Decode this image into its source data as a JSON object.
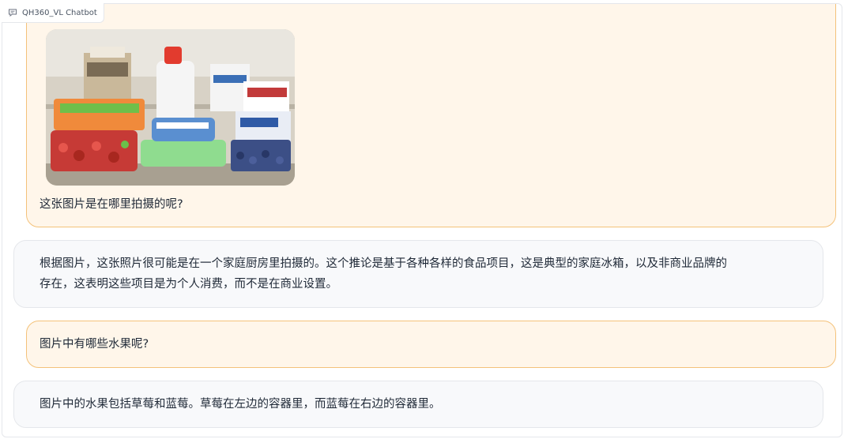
{
  "app": {
    "label": "QH360_VL Chatbot",
    "icon": "chat-icon"
  },
  "messages": [
    {
      "role": "user",
      "image": "fridge-photo",
      "text": "这张图片是在哪里拍摄的呢?"
    },
    {
      "role": "bot",
      "lines": [
        "根据图片，这张照片很可能是在一个家庭厨房里拍摄的。这个推论是基于各种各样的食品项目，这是典型的家庭冰箱，以及非商业品牌的",
        "存在，这表明这些项目是为个人消费，而不是在商业设置。"
      ]
    },
    {
      "role": "user",
      "text": "图片中有哪些水果呢?"
    },
    {
      "role": "bot",
      "text": "图片中的水果包括草莓和蓝莓。草莓在左边的容器里，而蓝莓在右边的容器里。"
    }
  ],
  "colors": {
    "user_bg": "#fff6ea",
    "user_border": "#f4c27a",
    "bot_bg": "#f8f9fb",
    "bot_border": "#e5e7eb"
  }
}
